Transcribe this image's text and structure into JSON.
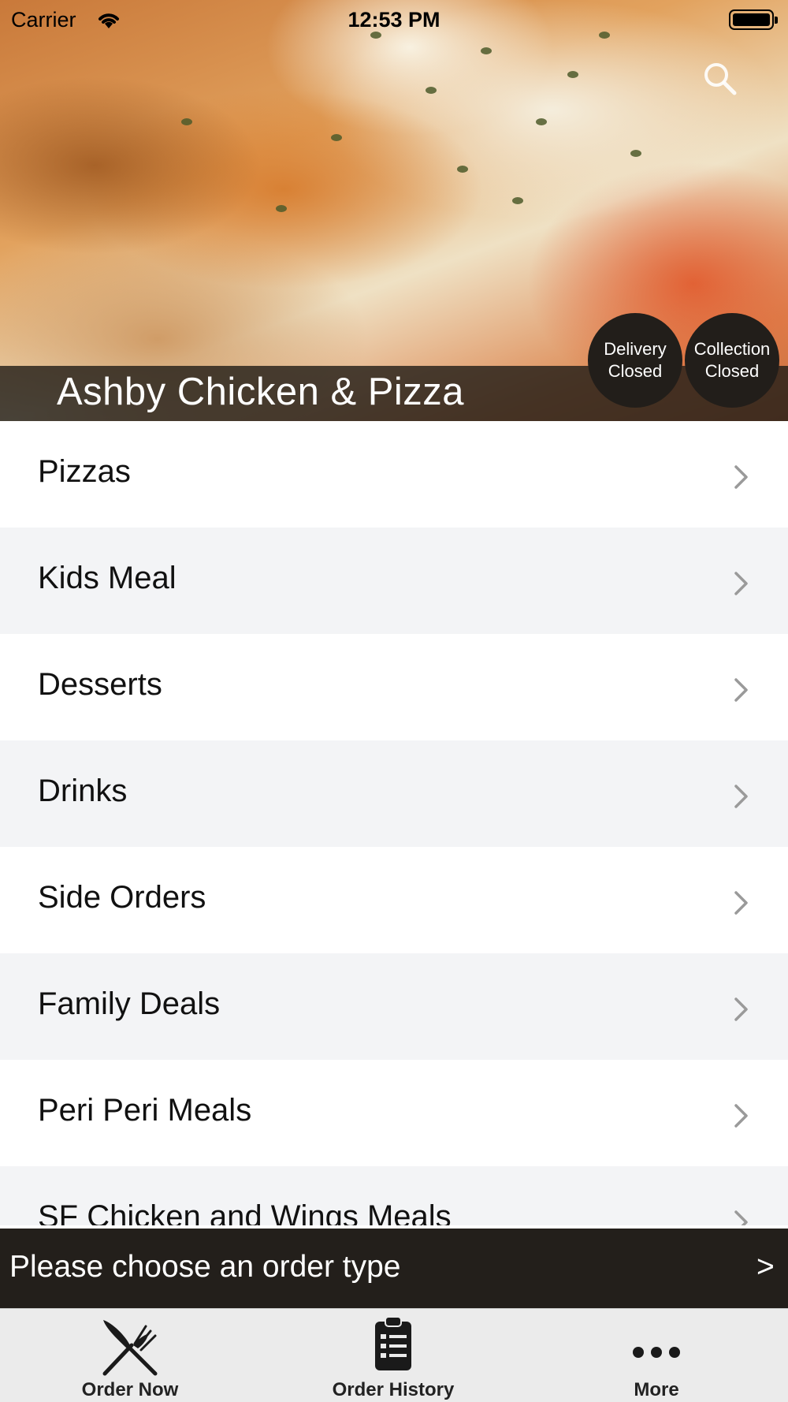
{
  "status_bar": {
    "carrier": "Carrier",
    "time": "12:53 PM"
  },
  "hero": {
    "restaurant_name": "Ashby Chicken & Pizza",
    "badges": {
      "delivery": {
        "line1": "Delivery",
        "line2": "Closed"
      },
      "collection": {
        "line1": "Collection",
        "line2": "Closed"
      }
    }
  },
  "menu": {
    "items": [
      {
        "label": "Pizzas"
      },
      {
        "label": "Kids Meal"
      },
      {
        "label": "Desserts"
      },
      {
        "label": "Drinks"
      },
      {
        "label": "Side Orders"
      },
      {
        "label": "Family Deals"
      },
      {
        "label": "Peri Peri Meals"
      },
      {
        "label": "SF Chicken and Wings Meals"
      }
    ]
  },
  "order_bar": {
    "text": "Please choose an order type",
    "arrow": ">"
  },
  "tab_bar": {
    "tabs": [
      {
        "label": "Order Now",
        "icon": "fork-knife-icon"
      },
      {
        "label": "Order History",
        "icon": "clipboard-list-icon"
      },
      {
        "label": "More",
        "icon": "more-dots-icon"
      }
    ]
  },
  "colors": {
    "dark_bar": "#231f1b",
    "alt_row": "#f3f4f6",
    "tab_bar_bg": "#ebebeb"
  }
}
